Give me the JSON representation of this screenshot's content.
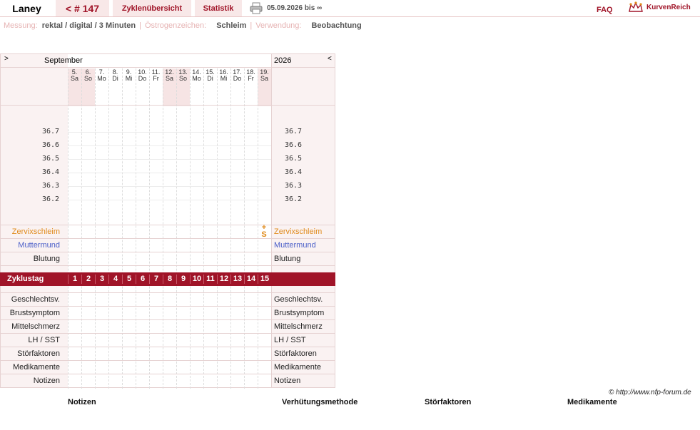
{
  "header": {
    "name": "Laney",
    "cycle": "< # 147",
    "overview": "Zyklenübersicht",
    "stats": "Statistik",
    "daterange": "05.09.2026 bis ∞",
    "faq": "FAQ",
    "brand": "KurvenReich"
  },
  "meta": {
    "messung_label": "Messung:",
    "messung_value": "rektal / digital / 3 Minuten",
    "oestrogen_label": "Östrogenzeichen:",
    "oestrogen_value": "Schleim",
    "verwendung_label": "Verwendung:",
    "verwendung_value": "Beobachtung",
    "separator": "|"
  },
  "chart": {
    "prev_arrow": ">",
    "next_arrow": "<",
    "month": "September",
    "year": "2026",
    "days": [
      {
        "num": "5.",
        "dow": "Sa",
        "weekend": true
      },
      {
        "num": "6.",
        "dow": "So",
        "weekend": true
      },
      {
        "num": "7.",
        "dow": "Mo",
        "weekend": false
      },
      {
        "num": "8.",
        "dow": "Di",
        "weekend": false
      },
      {
        "num": "9.",
        "dow": "Mi",
        "weekend": false
      },
      {
        "num": "10.",
        "dow": "Do",
        "weekend": false
      },
      {
        "num": "11.",
        "dow": "Fr",
        "weekend": false
      },
      {
        "num": "12.",
        "dow": "Sa",
        "weekend": true
      },
      {
        "num": "13.",
        "dow": "So",
        "weekend": true
      },
      {
        "num": "14.",
        "dow": "Mo",
        "weekend": false
      },
      {
        "num": "15.",
        "dow": "Di",
        "weekend": false
      },
      {
        "num": "16.",
        "dow": "Mi",
        "weekend": false
      },
      {
        "num": "17.",
        "dow": "Do",
        "weekend": false
      },
      {
        "num": "18.",
        "dow": "Fr",
        "weekend": false
      },
      {
        "num": "19.",
        "dow": "Sa",
        "weekend": true
      }
    ],
    "temperatures": [
      "36.7",
      "36.6",
      "36.5",
      "36.4",
      "36.3",
      "36.2"
    ],
    "cervix_label": "Zervixschleim",
    "cervix_mark": "S",
    "cervix_mark_plus": "+",
    "muttermund_label": "Muttermund",
    "blutung_label": "Blutung",
    "zyklustag_label": "Zyklustag",
    "cycle_days": [
      "1",
      "2",
      "3",
      "4",
      "5",
      "6",
      "7",
      "8",
      "9",
      "10",
      "11",
      "12",
      "13",
      "14",
      "15"
    ],
    "lower_rows": [
      "Geschlechtsv.",
      "Brustsymptom",
      "Mittelschmerz",
      "LH / SST",
      "Störfaktoren",
      "Medikamente",
      "Notizen"
    ]
  },
  "footer": {
    "credit": "© http://www.nfp-forum.de",
    "notizen": "Notizen",
    "methode": "Verhütungsmethode",
    "stoerfaktoren": "Störfaktoren",
    "medikamente": "Medikamente"
  }
}
